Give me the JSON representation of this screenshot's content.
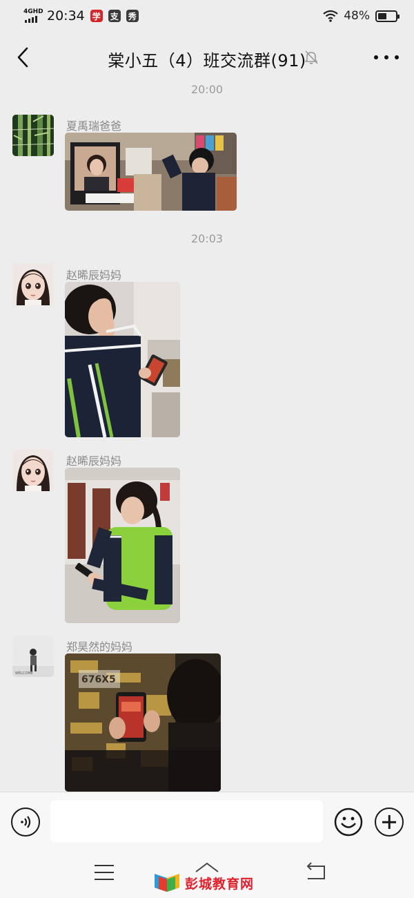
{
  "status_bar": {
    "network": "4GHD",
    "time": "20:34",
    "badges": [
      {
        "text": "学",
        "color": "#d4242b"
      },
      {
        "text": "支",
        "color": "#3b3b3b"
      },
      {
        "text": "秀",
        "color": "#3b3b3b"
      }
    ],
    "battery_percent": "48%",
    "battery_level": 0.48,
    "icons": [
      "signal-icon",
      "wifi-icon",
      "battery-icon"
    ]
  },
  "header": {
    "title": "棠小五（4）班交流群(91)",
    "icons": [
      "back-icon",
      "mute-icon",
      "more-icon"
    ]
  },
  "messages": [
    {
      "type": "timestamp",
      "text": "20:00"
    },
    {
      "type": "image",
      "sender": "夏禹瑞爸爸",
      "avatar": "bamboo-avatar",
      "image": "child-at-computer-photo"
    },
    {
      "type": "timestamp",
      "text": "20:03"
    },
    {
      "type": "image",
      "sender": "赵晞辰妈妈",
      "avatar": "cartoon-girl-avatar",
      "image": "girl-saluting-phone-photo"
    },
    {
      "type": "image",
      "sender": "赵晞辰妈妈",
      "avatar": "cartoon-girl-avatar",
      "image": "girl-reading-phone-photo"
    },
    {
      "type": "image",
      "sender": "郑昊然的妈妈",
      "avatar": "child-photo-avatar",
      "image": "child-holding-phone-photo"
    }
  ],
  "input_bar": {
    "placeholder": "",
    "icons": [
      "voice-icon",
      "emoji-icon",
      "plus-icon"
    ]
  },
  "nav_bar": {
    "icons": [
      "menu-icon",
      "home-icon",
      "back-nav-icon"
    ],
    "watermark": "彭城教育网"
  }
}
